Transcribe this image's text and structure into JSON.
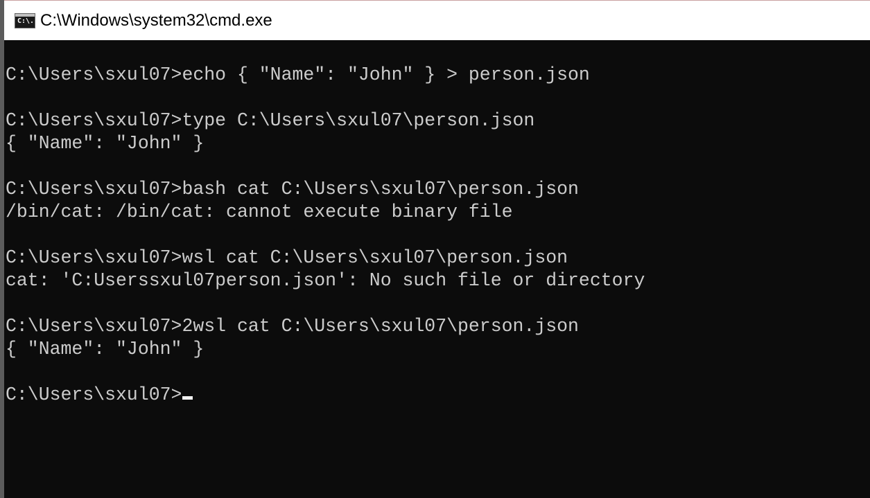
{
  "window": {
    "title": "C:\\Windows\\system32\\cmd.exe",
    "icon": "console-app-icon",
    "icon_text": "C:\\."
  },
  "console": {
    "lines": [
      "C:\\Users\\sxul07>echo { \"Name\": \"John\" } > person.json",
      "",
      "C:\\Users\\sxul07>type C:\\Users\\sxul07\\person.json",
      "{ \"Name\": \"John\" }",
      "",
      "C:\\Users\\sxul07>bash cat C:\\Users\\sxul07\\person.json",
      "/bin/cat: /bin/cat: cannot execute binary file",
      "",
      "C:\\Users\\sxul07>wsl cat C:\\Users\\sxul07\\person.json",
      "cat: 'C:Userssxul07person.json': No such file or directory",
      "",
      "C:\\Users\\sxul07>2wsl cat C:\\Users\\sxul07\\person.json",
      "{ \"Name\": \"John\" }",
      ""
    ],
    "prompt": "C:\\Users\\sxul07>"
  },
  "colors": {
    "background": "#0c0c0c",
    "foreground": "#cccccc",
    "titlebar": "#ffffff"
  }
}
